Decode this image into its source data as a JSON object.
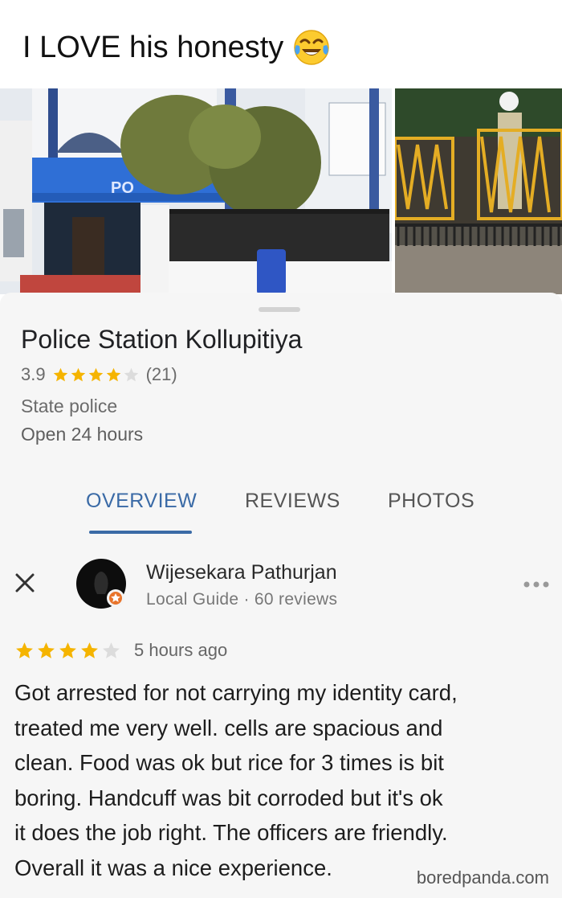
{
  "caption": {
    "text": "I LOVE his honesty",
    "emoji": "face-with-tears-of-joy"
  },
  "photos": {
    "main_sign_text": "PO",
    "main_description": "police-station-building-photo",
    "side_description": "yellow-gate-photo"
  },
  "place": {
    "name": "Police Station Kollupitiya",
    "rating": 3.9,
    "rating_text": "3.9",
    "stars_filled": 4,
    "stars_total": 5,
    "review_count": "(21)",
    "category": "State police",
    "hours": "Open 24 hours"
  },
  "tabs": [
    {
      "label": "OVERVIEW",
      "active": true
    },
    {
      "label": "REVIEWS",
      "active": false
    },
    {
      "label": "PHOTOS",
      "active": false
    }
  ],
  "review": {
    "reviewer": "Wijesekara Pathurjan",
    "meta": "Local Guide · 60 reviews",
    "stars_filled": 4,
    "stars_total": 5,
    "time": "5 hours ago",
    "text_lines": [
      "Got arrested for not carrying my identity card,",
      "treated me very well. cells are spacious and",
      "clean. Food was ok but rice for 3 times is bit",
      "boring. Handcuff was bit corroded but it's ok",
      "it does the job right. The officers are friendly.",
      "Overall it was a nice experience."
    ]
  },
  "watermark": "boredpanda.com",
  "colors": {
    "accent_blue": "#3a6aa6",
    "star_gold": "#f5b400",
    "star_empty": "#dcdcdc",
    "card_background": "#f6f6f6"
  }
}
